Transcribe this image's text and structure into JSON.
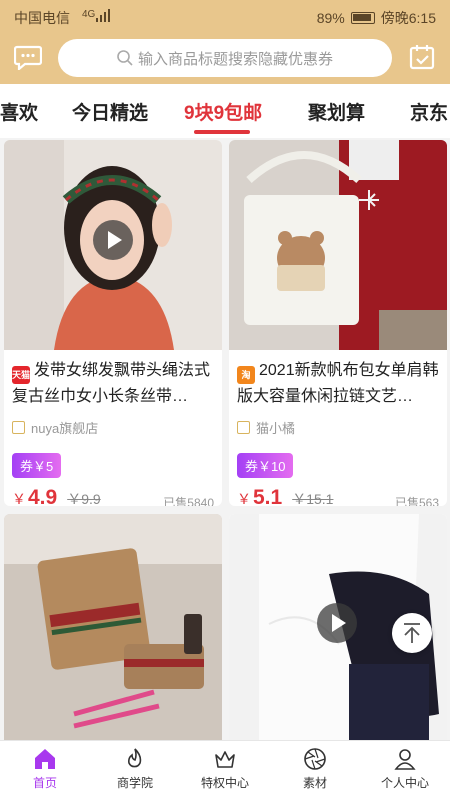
{
  "status_bar": {
    "carrier": "中国电信",
    "network": "4G",
    "battery": "89%",
    "time": "傍晚6:15"
  },
  "header": {
    "search_placeholder": "输入商品标题搜索隐藏优惠券"
  },
  "tabs": [
    {
      "label": "喜欢"
    },
    {
      "label": "今日精选"
    },
    {
      "label": "9块9包邮",
      "active": true
    },
    {
      "label": "聚划算"
    },
    {
      "label": "京东"
    }
  ],
  "products": [
    {
      "title": "发带女绑发飘带头绳法式复古丝巾女小长条丝带…",
      "platform_badge": "天猫",
      "shop": "nuya旗舰店",
      "coupon": "券￥5",
      "currency": "￥",
      "price": "4.9",
      "original_price": "￥9.9",
      "sold": "已售5840",
      "has_video": true
    },
    {
      "title": "2021新款帆布包女单肩韩版大容量休闲拉链文艺…",
      "platform_badge": "淘",
      "shop": "猫小橘",
      "coupon": "券￥10",
      "currency": "￥",
      "price": "5.1",
      "original_price": "￥15.1",
      "sold": "已售563",
      "has_video": false
    },
    {
      "title": "",
      "has_video": false
    },
    {
      "title": "",
      "has_video": true
    }
  ],
  "bottom_nav": [
    {
      "label": "首页",
      "active": true,
      "icon": "home-icon"
    },
    {
      "label": "商学院",
      "icon": "flame-icon"
    },
    {
      "label": "特权中心",
      "icon": "crown-icon"
    },
    {
      "label": "素材",
      "icon": "aperture-icon"
    },
    {
      "label": "个人中心",
      "icon": "person-icon"
    }
  ],
  "colors": {
    "header_bg": "#e8c68c",
    "accent_red": "#e0343b",
    "accent_purple": "#a838ee"
  }
}
